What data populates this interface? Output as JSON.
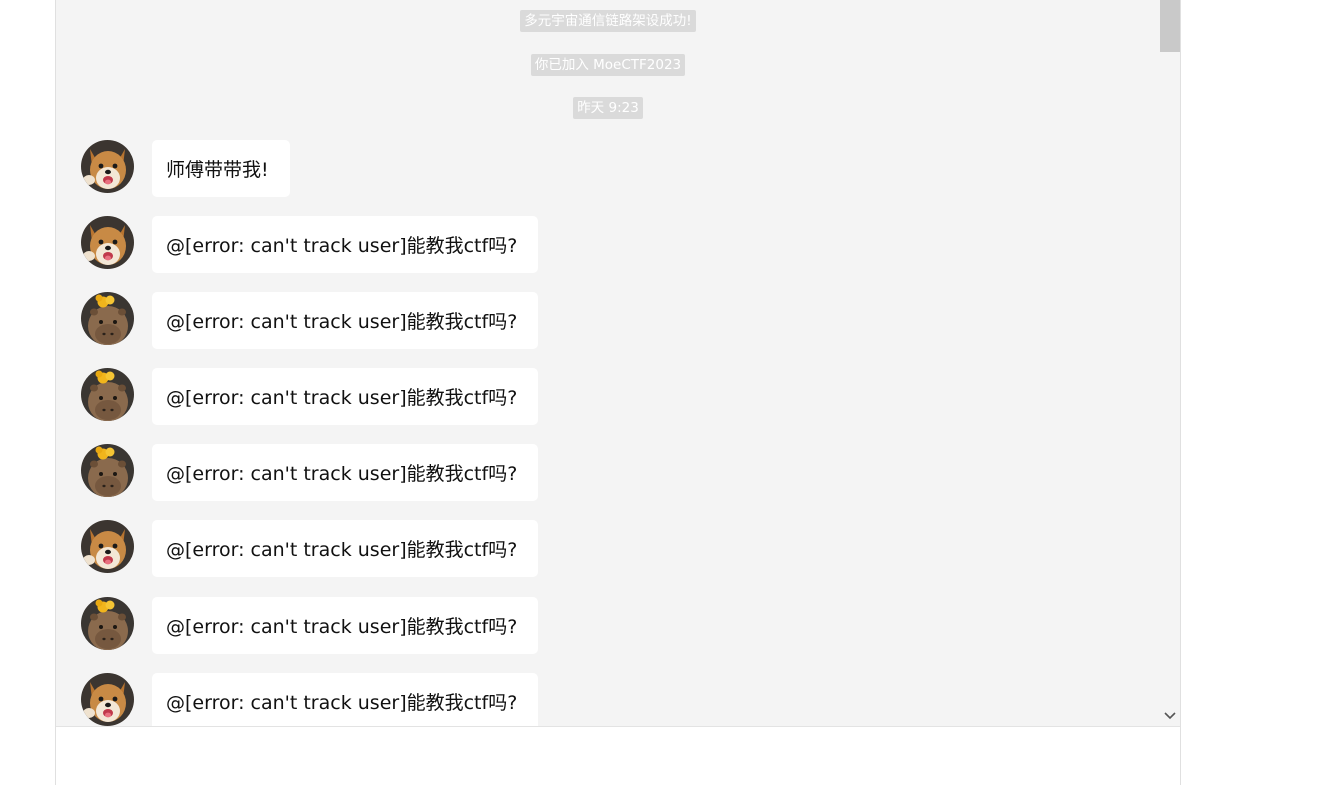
{
  "system_notices": [
    "多元宇宙通信链路架设成功!",
    "你已加入 MoeCTF2023",
    "昨天 9:23"
  ],
  "messages": [
    {
      "avatar": "shiba-avatar",
      "text": "师傅带带我!"
    },
    {
      "avatar": "shiba-avatar",
      "text": "@[error: can't track user]能教我ctf吗?"
    },
    {
      "avatar": "capybara-avatar",
      "text": "@[error: can't track user]能教我ctf吗?"
    },
    {
      "avatar": "capybara-avatar",
      "text": "@[error: can't track user]能教我ctf吗?"
    },
    {
      "avatar": "capybara-avatar",
      "text": "@[error: can't track user]能教我ctf吗?"
    },
    {
      "avatar": "shiba-avatar",
      "text": "@[error: can't track user]能教我ctf吗?"
    },
    {
      "avatar": "capybara-avatar",
      "text": "@[error: can't track user]能教我ctf吗?"
    },
    {
      "avatar": "shiba-avatar",
      "text": "@[error: can't track user]能教我ctf吗?"
    }
  ],
  "input": {
    "value": ""
  },
  "icons": {
    "scroll_down": "chevron-down-icon"
  },
  "colors": {
    "chat_background": "#f4f4f4",
    "bubble": "#ffffff",
    "notice": "#dadada"
  }
}
